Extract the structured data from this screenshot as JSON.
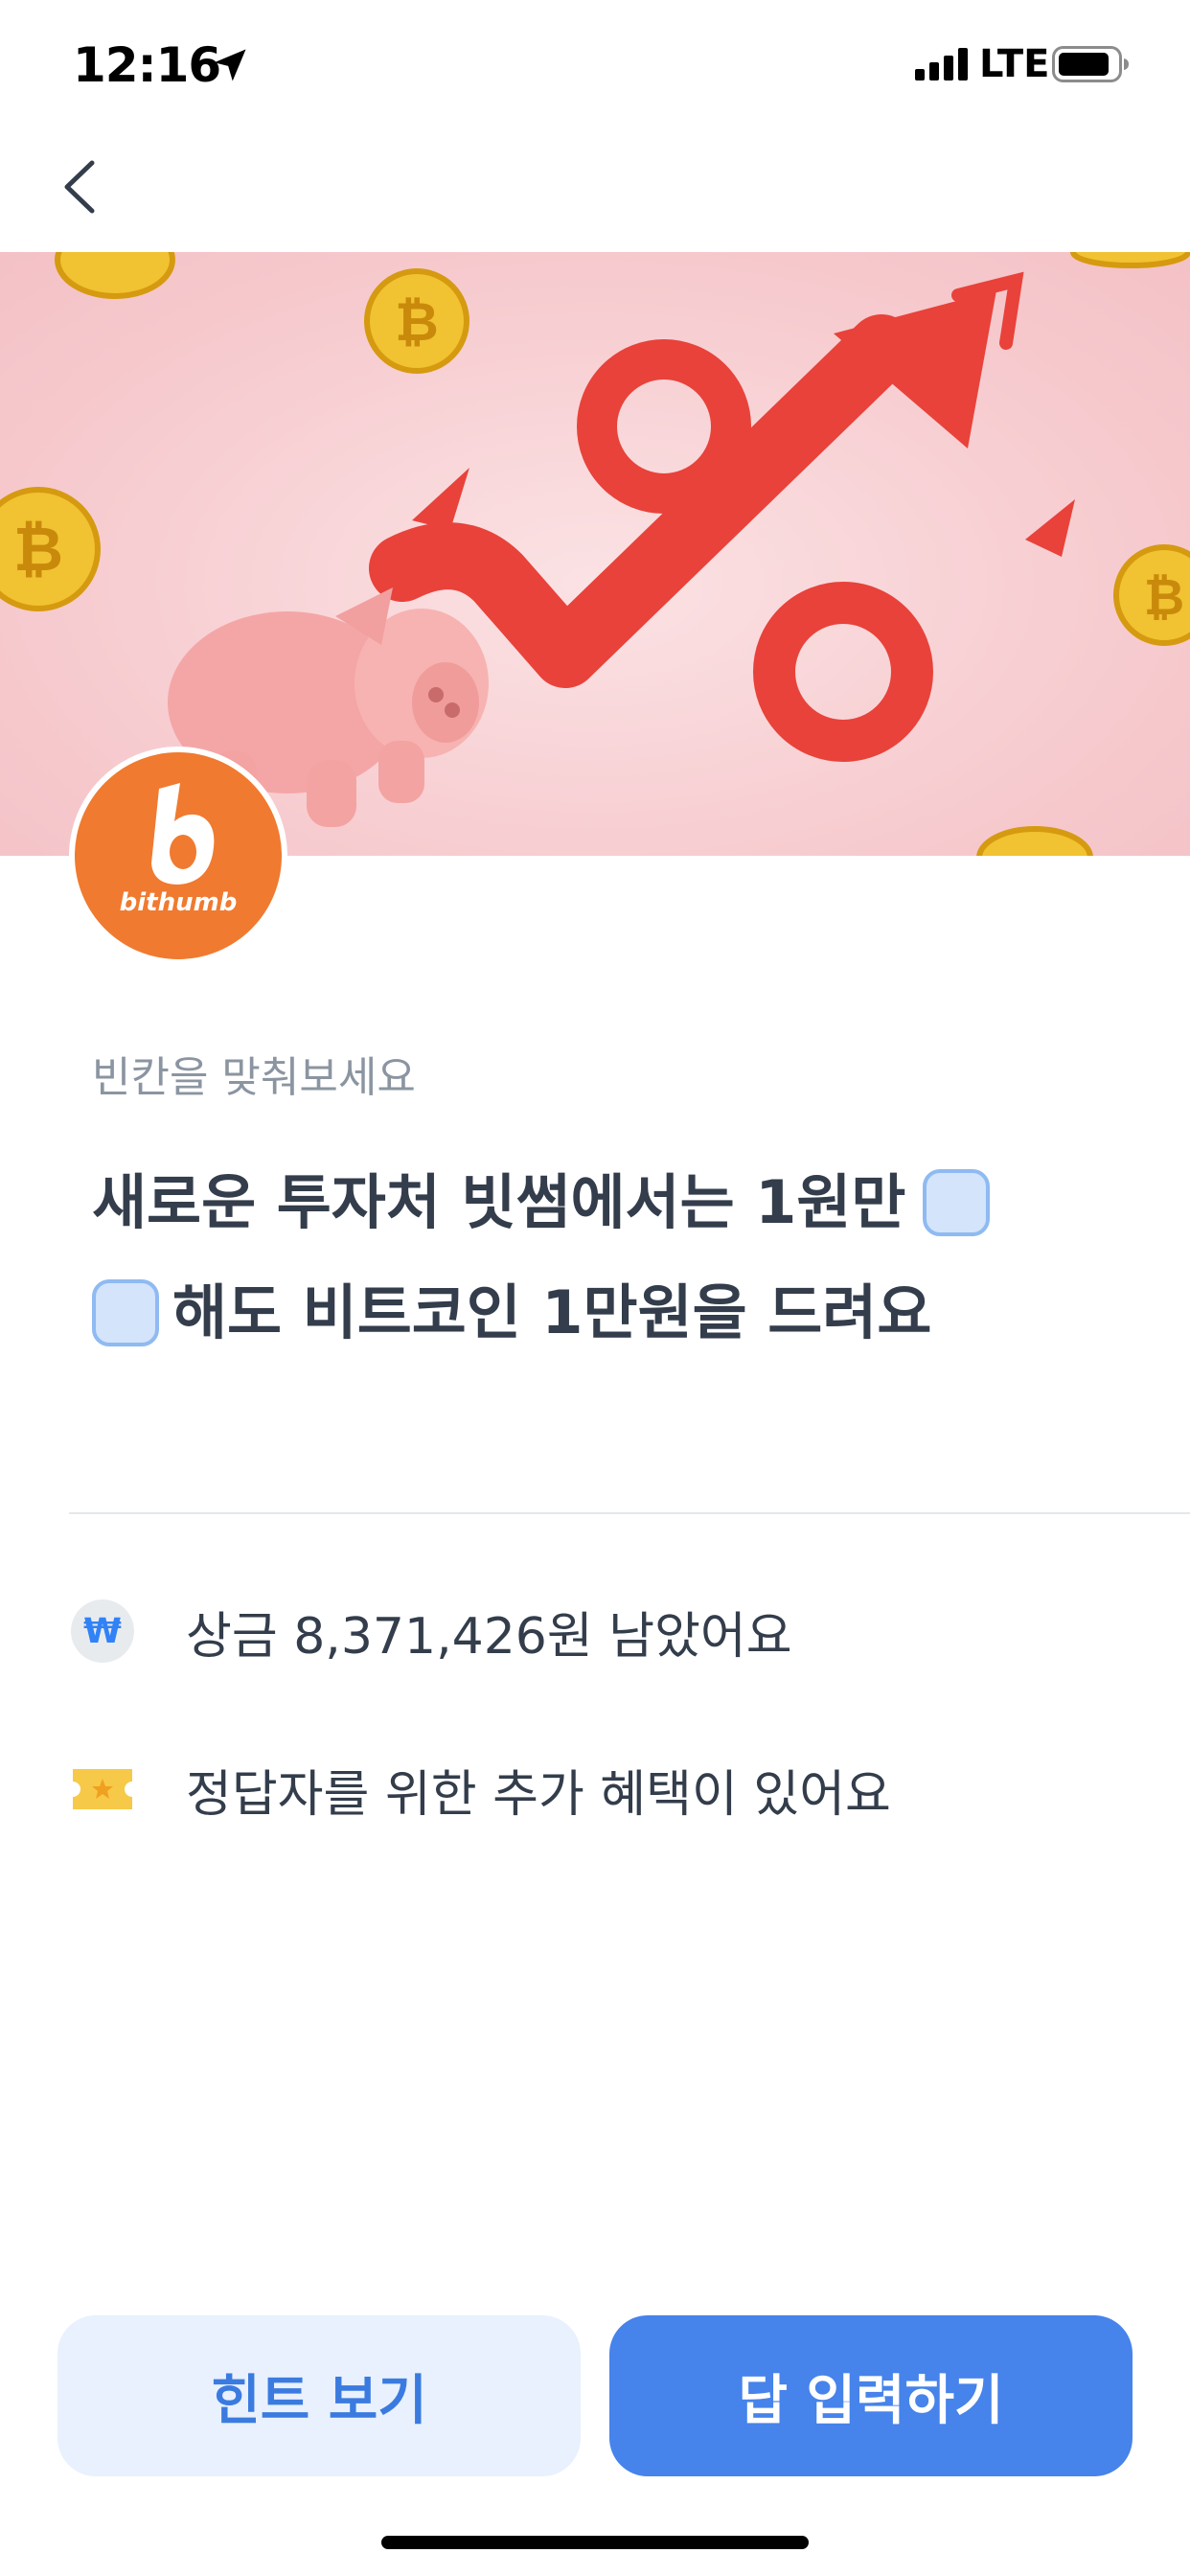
{
  "status_bar": {
    "time": "12:16",
    "network": "LTE",
    "icons": [
      "location-arrow-icon",
      "signal-icon",
      "battery-icon"
    ]
  },
  "nav": {
    "back_icon": "chevron-left-icon"
  },
  "brand": {
    "name": "bithumb",
    "color": "#f07a2f"
  },
  "question": {
    "prompt": "빈칸을 맞춰보세요",
    "line1": "새로운 투자처 빗썸에서는 1원만",
    "line2": "해도 비트코인 1만원을 드려요"
  },
  "info": {
    "prize_icon": "won-icon",
    "prize_symbol": "₩",
    "prize_text": "상금 8,371,426원 남았어요",
    "benefit_icon": "ticket-icon",
    "benefit_text": "정답자를 위한 추가 혜택이 있어요"
  },
  "buttons": {
    "hint_label": "힌트 보기",
    "answer_label": "답 입력하기"
  },
  "colors": {
    "primary": "#4683ea",
    "primary_light": "#e8f1fd",
    "blank_fill": "#d3e4fb",
    "blank_border": "#8fbaf2",
    "banner_bg": "#f6c9cd"
  }
}
